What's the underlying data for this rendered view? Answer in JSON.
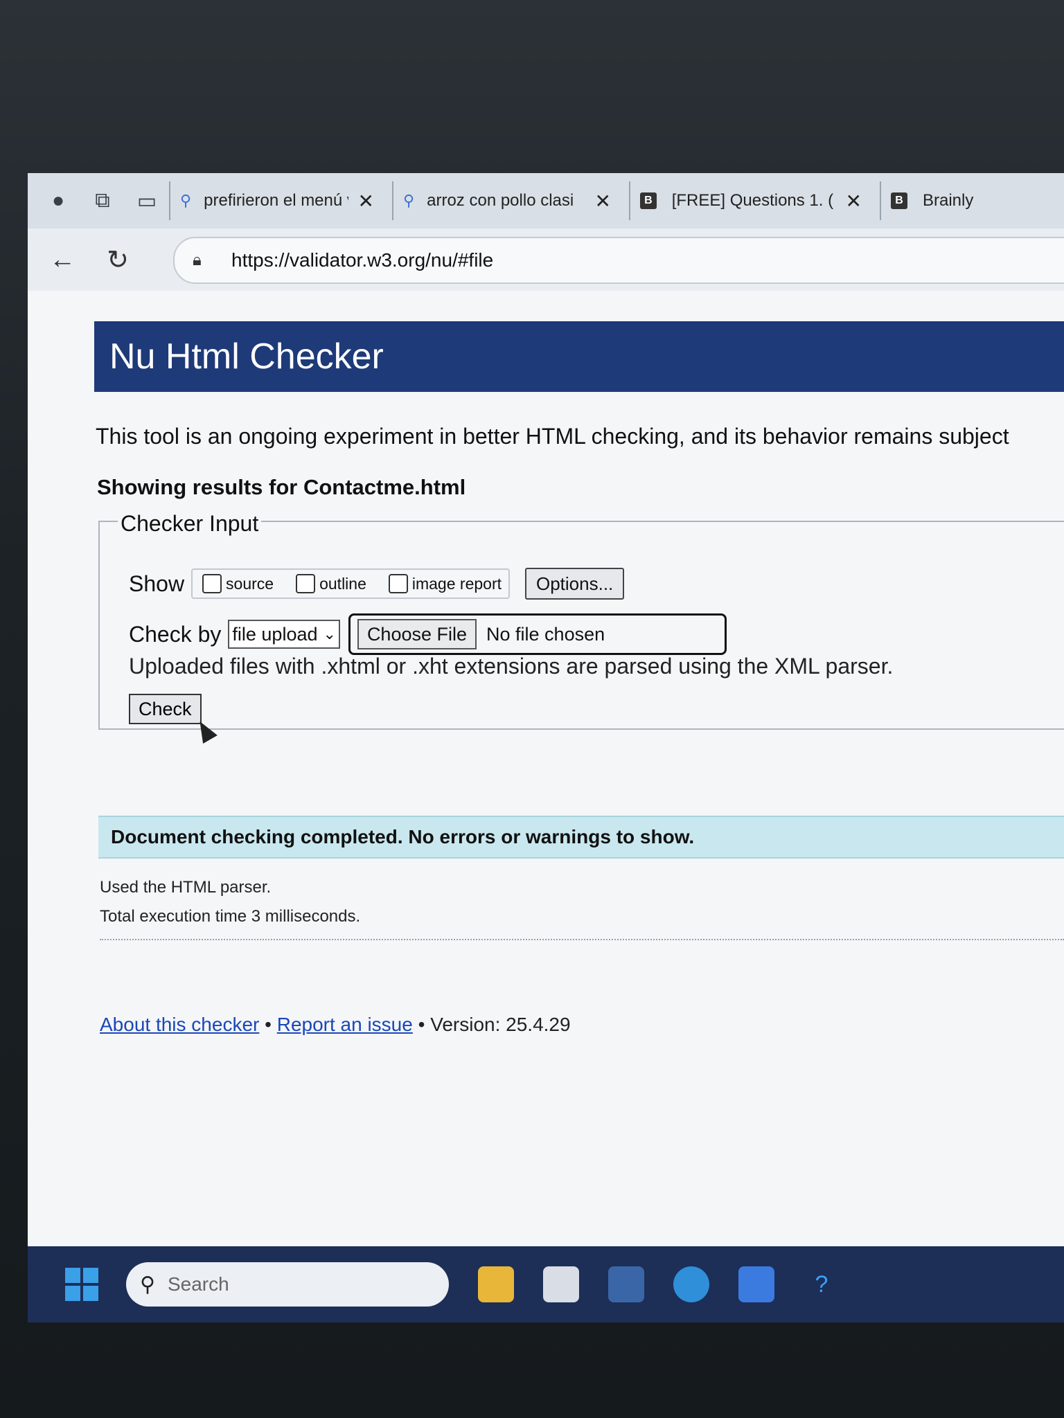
{
  "tabs": [
    {
      "title": "prefirieron el menú v",
      "icon": "search-icon"
    },
    {
      "title": "arroz con pollo clasi",
      "icon": "search-icon"
    },
    {
      "title": "[FREE] Questions 1. (",
      "icon": "brainly-icon"
    },
    {
      "title": "Brainly",
      "icon": "brainly-icon"
    }
  ],
  "address": {
    "url": "https://validator.w3.org/nu/#file"
  },
  "page": {
    "title": "Nu Html Checker",
    "intro": "This tool is an ongoing experiment in better HTML checking, and its behavior remains subject",
    "showing": "Showing results for Contactme.html",
    "checker_input": {
      "legend": "Checker Input",
      "show_label": "Show",
      "checkboxes": {
        "source": "source",
        "outline": "outline",
        "image_report": "image report"
      },
      "options_label": "Options...",
      "check_by_label": "Check by",
      "check_by_value": "file upload",
      "choose_file_label": "Choose File",
      "no_file_label": "No file chosen",
      "upload_note": "Uploaded files with .xhtml or .xht extensions are parsed using the XML parser.",
      "check_label": "Check"
    },
    "result": {
      "success": "Document checking completed. No errors or warnings to show.",
      "parser": "Used the HTML parser.",
      "exec_time": "Total execution time 3 milliseconds."
    },
    "footer": {
      "about": "About this checker",
      "sep": "•",
      "report": "Report an issue",
      "version": "Version: 25.4.29"
    }
  },
  "taskbar": {
    "search_placeholder": "Search"
  }
}
